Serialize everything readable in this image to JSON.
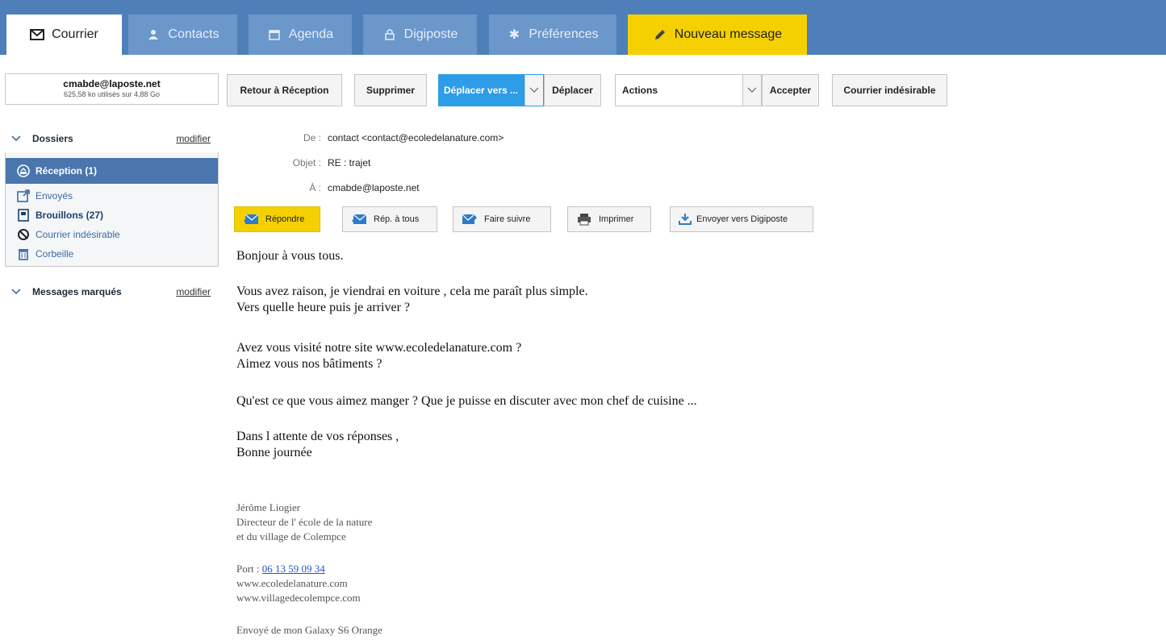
{
  "nav": {
    "tabs": [
      {
        "label": "Courrier",
        "icon": "envelope-icon"
      },
      {
        "label": "Contacts",
        "icon": "person-icon"
      },
      {
        "label": "Agenda",
        "icon": "calendar-icon"
      },
      {
        "label": "Digiposte",
        "icon": "lock-icon"
      },
      {
        "label": "Préférences",
        "icon": "gear-icon"
      },
      {
        "label": "Nouveau message",
        "icon": "pencil-icon"
      }
    ]
  },
  "account": {
    "email": "cmabde@laposte.net",
    "usage": "625,58 ko utilisés sur 4,88 Go"
  },
  "sidebar": {
    "folders_title": "Dossiers",
    "modify_label": "modifier",
    "folders": [
      {
        "label": "Réception (1)",
        "icon": "inbox-icon"
      },
      {
        "label": "Envoyés",
        "icon": "sent-icon"
      },
      {
        "label": "Brouillons (27)",
        "icon": "drafts-icon"
      },
      {
        "label": "Courrier indésirable",
        "icon": "blocked-icon"
      },
      {
        "label": "Corbeille",
        "icon": "trash-icon"
      }
    ],
    "marked_title": "Messages marqués",
    "marked_modify_label": "modifier"
  },
  "toolbar": {
    "back": "Retour à Réception",
    "delete": "Supprimer",
    "move_to": "Déplacer vers ...",
    "move": "Déplacer",
    "actions": "Actions",
    "accept": "Accepter",
    "spam": "Courrier indésirable"
  },
  "message": {
    "from_label": "De :",
    "from": "contact <contact@ecoledelanature.com>",
    "subject_label": "Objet :",
    "subject": "RE : trajet",
    "to_label": "À :",
    "to": "cmabde@laposte.net"
  },
  "actions": {
    "reply": "Répondre",
    "reply_all": "Rép. à tous",
    "forward": "Faire suivre",
    "print": "Imprimer",
    "send_digiposte": "Envoyer vers Digiposte"
  },
  "body": {
    "greeting": "Bonjour à  vous tous.",
    "p1_l1": "Vous avez raison, je viendrai en voiture , cela me paraît plus simple.",
    "p1_l2": "Vers quelle heure puis je arriver ?",
    "p2_l1": "Avez vous visité notre site www.ecoledelanature.com ?",
    "p2_l2": "Aimez vous nos bâtiments ?",
    "p3": "Qu'est ce que vous aimez manger ? Que je puisse en discuter avec mon chef de cuisine ...",
    "p4_l1": "Dans l attente de vos réponses ,",
    "p4_l2": "Bonne journée"
  },
  "signature": {
    "name": "Jérôme Liogier",
    "title_l1": "Directeur de l' école de la nature",
    "title_l2": "et du village de Colempce",
    "port_label": "Port :",
    "phone": "06 13 59 09 34",
    "site1": "www.ecoledelanature.com",
    "site2": "www.villagedecolempce.com",
    "sent_from": "Envoyé de mon Galaxy S6 Orange"
  }
}
